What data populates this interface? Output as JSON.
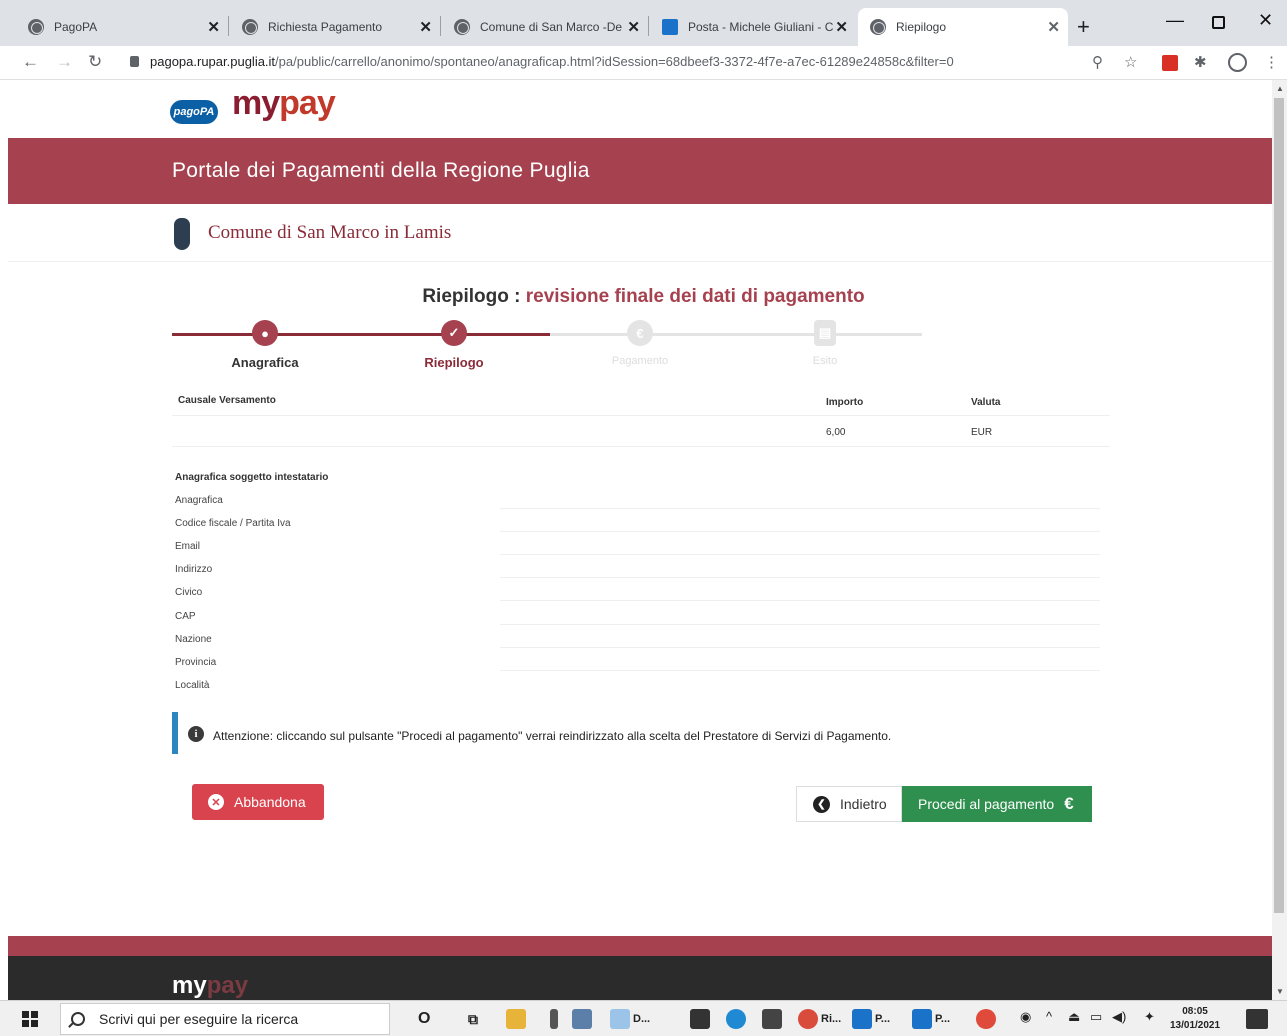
{
  "browser": {
    "tabs": [
      {
        "label": "PagoPA",
        "active": false,
        "icon": "globe-icon"
      },
      {
        "label": "Richiesta Pagamento",
        "active": false,
        "icon": "globe-icon"
      },
      {
        "label": "Comune di San Marco -De",
        "active": false,
        "icon": "globe-icon"
      },
      {
        "label": "Posta - Michele Giuliani - C",
        "active": false,
        "icon": "outlook-icon"
      },
      {
        "label": "Riepilogo",
        "active": true,
        "icon": "globe-icon"
      }
    ],
    "url_host": "pagopa.rupar.puglia.it",
    "url_path": "/pa/public/carrello/anonimo/spontaneo/anagraficap.html?idSession=68dbeef3-3372-4f7e-a7ec-61289e24858c&filter=0"
  },
  "header": {
    "pagopa_logo": "pagoPA",
    "mypay_my": "my",
    "mypay_pay": "pay",
    "portal_title": "Portale dei Pagamenti della Regione Puglia",
    "ente_name": "Comune di San Marco in Lamis"
  },
  "heading": {
    "prefix": "Riepilogo : ",
    "highlight": "revisione finale dei dati di pagamento"
  },
  "steps": [
    {
      "label": "Anagrafica",
      "state": "done",
      "icon": "user-icon"
    },
    {
      "label": "Riepilogo",
      "state": "current",
      "icon": "check-icon"
    },
    {
      "label": "Pagamento",
      "state": "todo",
      "icon": "euro-icon"
    },
    {
      "label": "Esito",
      "state": "todo",
      "icon": "document-icon"
    }
  ],
  "summary": {
    "col_causale": "Causale Versamento",
    "col_importo": "Importo",
    "col_valuta": "Valuta",
    "importo": "6,00",
    "valuta": "EUR"
  },
  "anagrafica": {
    "section_title": "Anagrafica soggetto intestatario",
    "labels": [
      "Anagrafica",
      "Codice fiscale / Partita Iva",
      "Email",
      "Indirizzo",
      "Civico",
      "CAP",
      "Nazione",
      "Provincia",
      "Località"
    ]
  },
  "notice": "Attenzione: cliccando sul pulsante \"Procedi al pagamento\" verrai reindirizzato alla scelta del Prestatore di Servizi di Pagamento.",
  "buttons": {
    "abbandona": "Abbandona",
    "indietro": "Indietro",
    "procedi": "Procedi al pagamento",
    "euro_symbol": "€"
  },
  "taskbar": {
    "search_placeholder": "Scrivi qui per eseguire la ricerca",
    "app_labels": [
      "D...",
      "Ri...",
      "P...",
      "P..."
    ],
    "time": "08:05",
    "date": "13/01/2021"
  },
  "colors": {
    "brand_red": "#a6424f",
    "button_green": "#2f8f4e",
    "button_red": "#d9434e",
    "info_blue": "#2e86c1"
  }
}
